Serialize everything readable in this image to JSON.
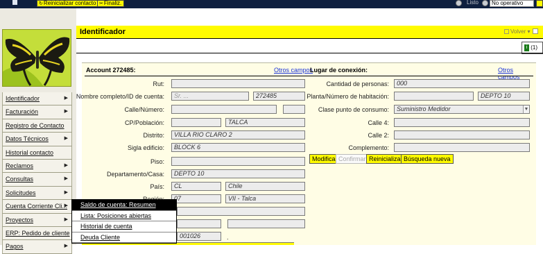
{
  "toolbar": {
    "reset_contact": "Reinicializar contacto",
    "finish": "Finaliz.",
    "status_listo": "Listo",
    "status_no_operativo": "No operativo"
  },
  "sidebar": {
    "items": [
      {
        "label": "Identificador",
        "arrow": true
      },
      {
        "label": "Facturación",
        "arrow": true
      },
      {
        "label": "Registro de Contacto",
        "arrow": false
      },
      {
        "label": "Datos Técnicos",
        "arrow": true
      },
      {
        "label": "Historial contacto",
        "arrow": false
      },
      {
        "label": "Reclamos",
        "arrow": true
      },
      {
        "label": "Consultas",
        "arrow": true
      },
      {
        "label": "Solicitudes",
        "arrow": true
      },
      {
        "label": "Cuenta Corriente Cli...",
        "arrow": true
      },
      {
        "label": "Proyectos",
        "arrow": true
      },
      {
        "label": "ERP: Pedido de cliente",
        "arrow": false
      },
      {
        "label": "Pagos",
        "arrow": true
      }
    ]
  },
  "popup_menu": {
    "items": [
      {
        "label": "Saldo de cuenta: Resumen",
        "active": true
      },
      {
        "label": "Lista: Posiciones abiertas",
        "active": false
      },
      {
        "label": "Historial de cuenta",
        "active": false
      },
      {
        "label": "Deuda Cliente",
        "active": false
      }
    ]
  },
  "header": {
    "title": "Identificador",
    "back_label": "Volver",
    "badge_count": "(1)"
  },
  "account": {
    "title": "Account 272485:",
    "otros_campos": "Otros campos",
    "labels": {
      "rut": "Rut:",
      "nombre": "Nombre completo/ID de cuenta:",
      "calle": "Calle/Número:",
      "cp": "CP/Población:",
      "distrito": "Distrito:",
      "sigla": "Sigla edificio:",
      "piso": "Piso:",
      "depto": "Departamento/Casa:",
      "pais": "País:",
      "region": "Región:"
    },
    "values": {
      "rut": "",
      "nombre_prefix": "Sr. ...",
      "nombre_id": "272485",
      "calle": "",
      "numero": "",
      "cp": "",
      "poblacion": "TALCA",
      "distrito": "VILLA RIO CLARO 2",
      "sigla": "BLOCK 6",
      "piso": "",
      "depto": "DEPTO 10",
      "pais_code": "CL",
      "pais_name": "Chile",
      "region_code": "07",
      "region_name": "VII - Talca",
      "partial_number": "001026",
      "dot": "."
    }
  },
  "connection": {
    "title": "Lugar de conexión:",
    "otros_campos": "Otros campos",
    "labels": {
      "cantidad": "Cantidad de personas:",
      "planta": "Planta/Número de habitación:",
      "clase": "Clase punto de consumo:",
      "calle4": "Calle 4:",
      "calle2": "Calle 2:",
      "complemento": "Complemento:"
    },
    "values": {
      "cantidad": "000",
      "planta": "",
      "habitacion": "DEPTO 10",
      "clase": "Suministro Medidor",
      "calle4": "",
      "calle2": "",
      "complemento": ""
    },
    "buttons": {
      "modificar": "Modificar",
      "confirmar": "Confirmar",
      "reinicializar": "Reinicializar",
      "busqueda": "Búsqueda nueva"
    }
  }
}
